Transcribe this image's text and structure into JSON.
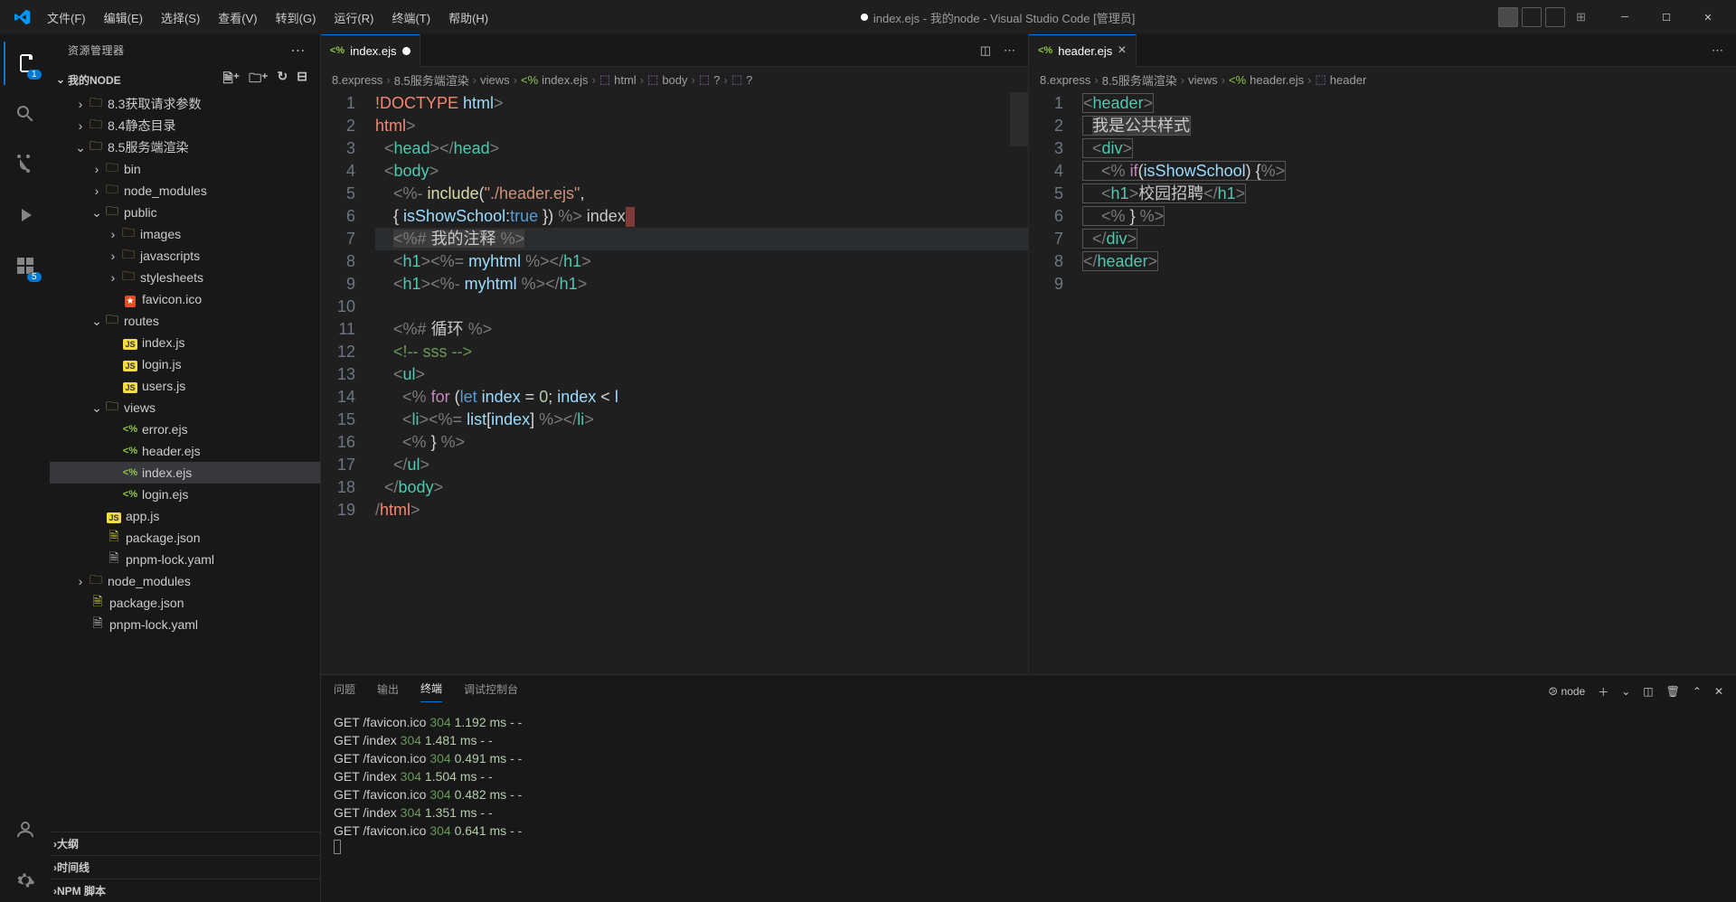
{
  "menu": [
    "文件(F)",
    "编辑(E)",
    "选择(S)",
    "查看(V)",
    "转到(G)",
    "运行(R)",
    "终端(T)",
    "帮助(H)"
  ],
  "title": "index.ejs - 我的node - Visual Studio Code [管理员]",
  "explorer": {
    "title": "资源管理器",
    "root": "我的NODE",
    "tree": {
      "n83": "8.3获取请求参数",
      "n84": "8.4静态目录",
      "n85": "8.5服务端渲染",
      "bin": "bin",
      "node_modules": "node_modules",
      "public": "public",
      "images": "images",
      "javascripts": "javascripts",
      "stylesheets": "stylesheets",
      "favicon": "favicon.ico",
      "routes": "routes",
      "index_js": "index.js",
      "login_js": "login.js",
      "users_js": "users.js",
      "views": "views",
      "error_ejs": "error.ejs",
      "header_ejs": "header.ejs",
      "index_ejs": "index.ejs",
      "login_ejs": "login.ejs",
      "app_js": "app.js",
      "package_json": "package.json",
      "pnpm_lock": "pnpm-lock.yaml",
      "node_modules2": "node_modules",
      "package_json2": "package.json",
      "pnpm_lock2": "pnpm-lock.yaml"
    },
    "outline": "大纲",
    "timeline": "时间线",
    "npm_scripts": "NPM 脚本"
  },
  "editor_left": {
    "tab": "index.ejs",
    "breadcrumb": [
      "8.express",
      "8.5服务端渲染",
      "views",
      "index.ejs",
      "html",
      "body",
      "?",
      "?"
    ]
  },
  "editor_right": {
    "tab": "header.ejs",
    "breadcrumb": [
      "8.express",
      "8.5服务端渲染",
      "views",
      "header.ejs",
      "header"
    ]
  },
  "code_left_count": 19,
  "code_right_count": 9,
  "panel": {
    "tabs": {
      "problems": "问题",
      "output": "输出",
      "terminal": "终端",
      "debug": "调试控制台"
    },
    "term_label": "node",
    "lines": [
      "GET /favicon.ico 304 1.192 ms - -",
      "GET /index 304 1.481 ms - -",
      "GET /favicon.ico 304 0.491 ms - -",
      "GET /index 304 1.504 ms - -",
      "GET /favicon.ico 304 0.482 ms - -",
      "GET /index 304 1.351 ms - -",
      "GET /favicon.ico 304 0.641 ms - -"
    ]
  }
}
